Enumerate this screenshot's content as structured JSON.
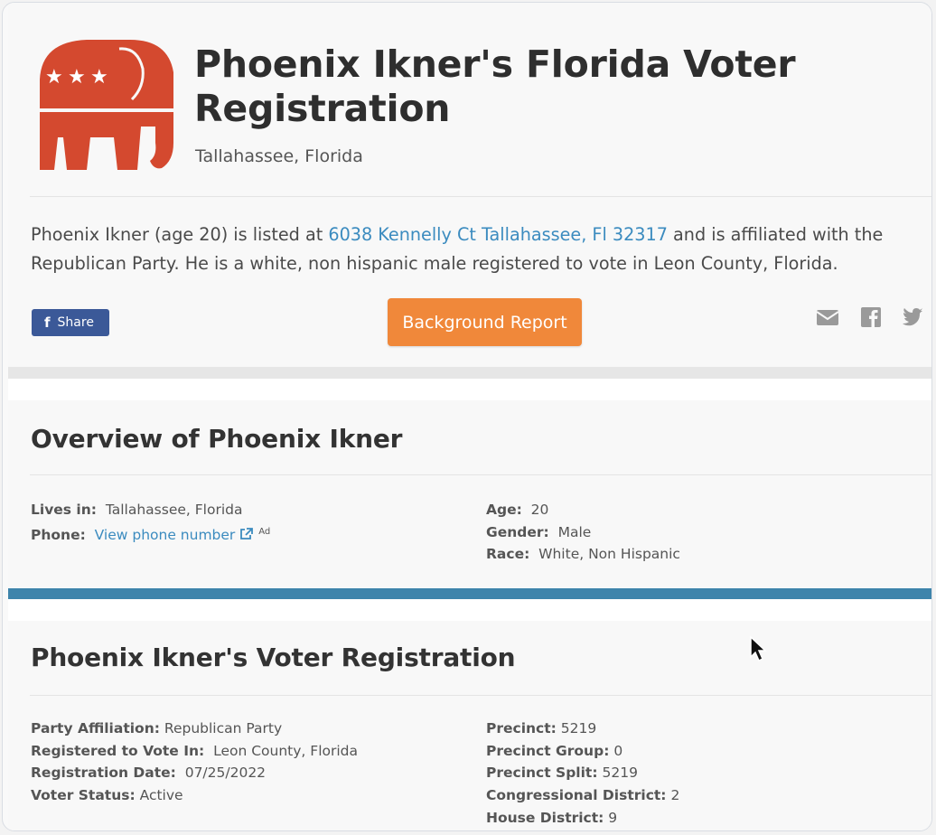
{
  "header": {
    "title": "Phoenix Ikner's Florida Voter Registration",
    "location": "Tallahassee, Florida",
    "logo_icon": "republican-elephant-icon",
    "logo_color": "#d4492f"
  },
  "summary": {
    "part1": "Phoenix Ikner (age 20) is listed at ",
    "address_link": "6038 Kennelly Ct Tallahassee, Fl 32317",
    "part2": " and is affiliated with the Republican Party. He is a white, non hispanic male registered to vote in Leon County, Florida."
  },
  "actions": {
    "share_label": "Share",
    "background_report_label": "Background Report",
    "social_icons": [
      "email-icon",
      "facebook-icon",
      "twitter-icon"
    ]
  },
  "overview": {
    "heading": "Overview of Phoenix Ikner",
    "lives_in_label": "Lives in:",
    "lives_in_value": "Tallahassee, Florida",
    "phone_label": "Phone:",
    "phone_link": "View phone number",
    "phone_ad": "Ad",
    "age_label": "Age:",
    "age_value": "20",
    "gender_label": "Gender:",
    "gender_value": "Male",
    "race_label": "Race:",
    "race_value": "White, Non Hispanic"
  },
  "registration": {
    "heading": "Phoenix Ikner's Voter Registration",
    "party_label": "Party Affiliation:",
    "party_value": "Republican Party",
    "registered_label": "Registered to Vote In:",
    "registered_value": "Leon County, Florida",
    "date_label": "Registration Date:",
    "date_value": "07/25/2022",
    "status_label": "Voter Status:",
    "status_value": "Active",
    "precinct_label": "Precinct:",
    "precinct_value": "5219",
    "precinct_group_label": "Precinct Group:",
    "precinct_group_value": "0",
    "precinct_split_label": "Precinct Split:",
    "precinct_split_value": "5219",
    "congressional_label": "Congressional District:",
    "congressional_value": "2",
    "house_label": "House District:",
    "house_value": "9"
  },
  "colors": {
    "link": "#3b8bbf",
    "accent_button": "#f0883a",
    "facebook": "#3b5998",
    "divider_bar": "#3e84ab"
  }
}
